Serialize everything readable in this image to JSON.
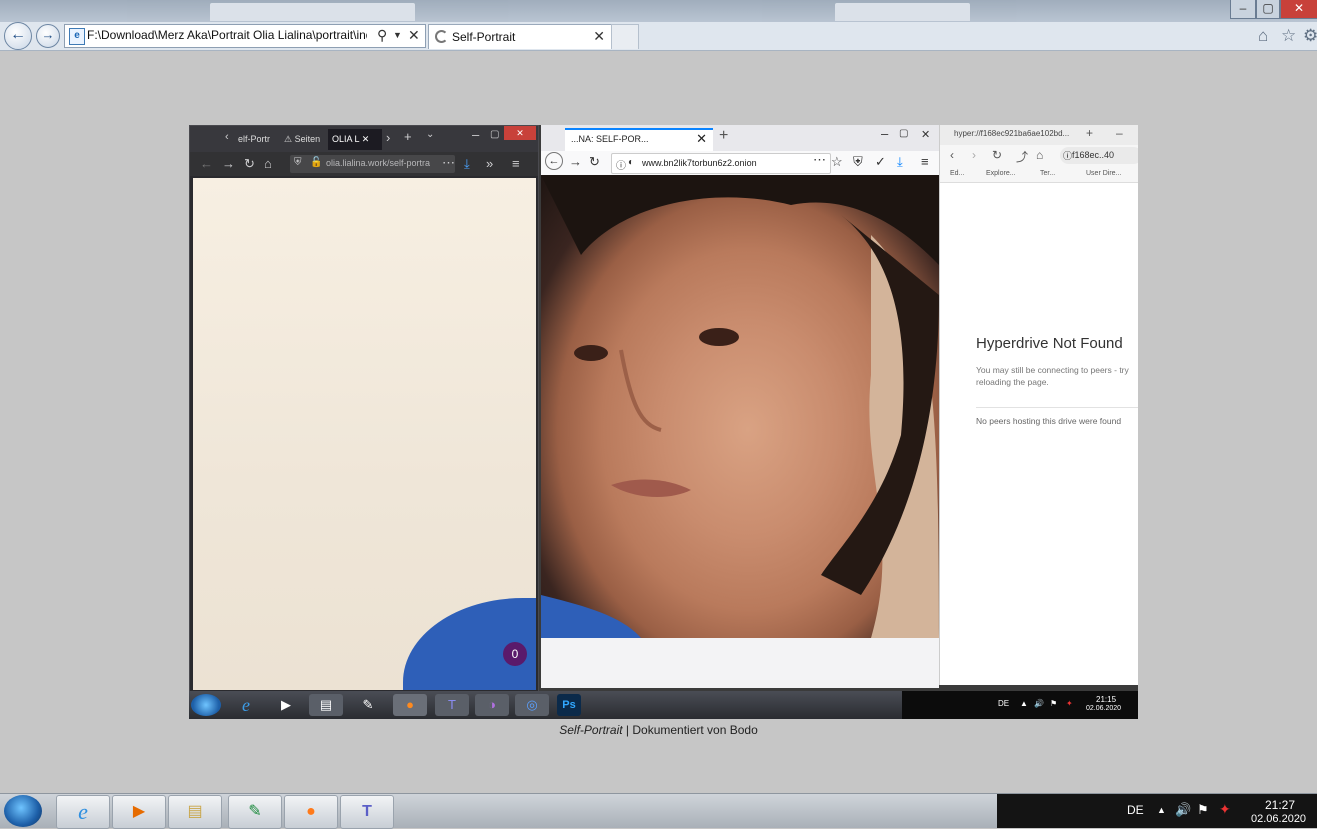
{
  "browser": {
    "address": "F:\\Download\\Merz Aka\\Portrait Olia Lialina\\portrait\\index.l",
    "tab_title": "Self-Portrait"
  },
  "firefox_window": {
    "tabs": [
      "elf-Portr",
      "Seiten",
      "OLIA L"
    ],
    "url": "olia.lialina.work/self-portra",
    "badge_count": "0"
  },
  "tor_window": {
    "tab_title": "...NA: SELF-POR...",
    "url": "www.bn2lik7torbun6z2.onion"
  },
  "beaker_window": {
    "tab_title": "hyper://f168ec921ba6ae102bd...",
    "url_short": "f168ec..40",
    "bookmarks": [
      "Ed...",
      "Explore...",
      "Ter...",
      "User Dire..."
    ],
    "heading": "Hyperdrive Not Found",
    "message": "You may still be connecting to peers - try reloading the page.",
    "no_peers": "No peers hosting this drive were found"
  },
  "inner_taskbar": {
    "language": "DE",
    "time": "21:15",
    "date": "02.06.2020"
  },
  "caption": {
    "title": "Self-Portrait",
    "rest": " | Dokumentiert von Bodo"
  },
  "taskbar": {
    "language": "DE",
    "time": "21:27",
    "date": "02.06.2020"
  }
}
